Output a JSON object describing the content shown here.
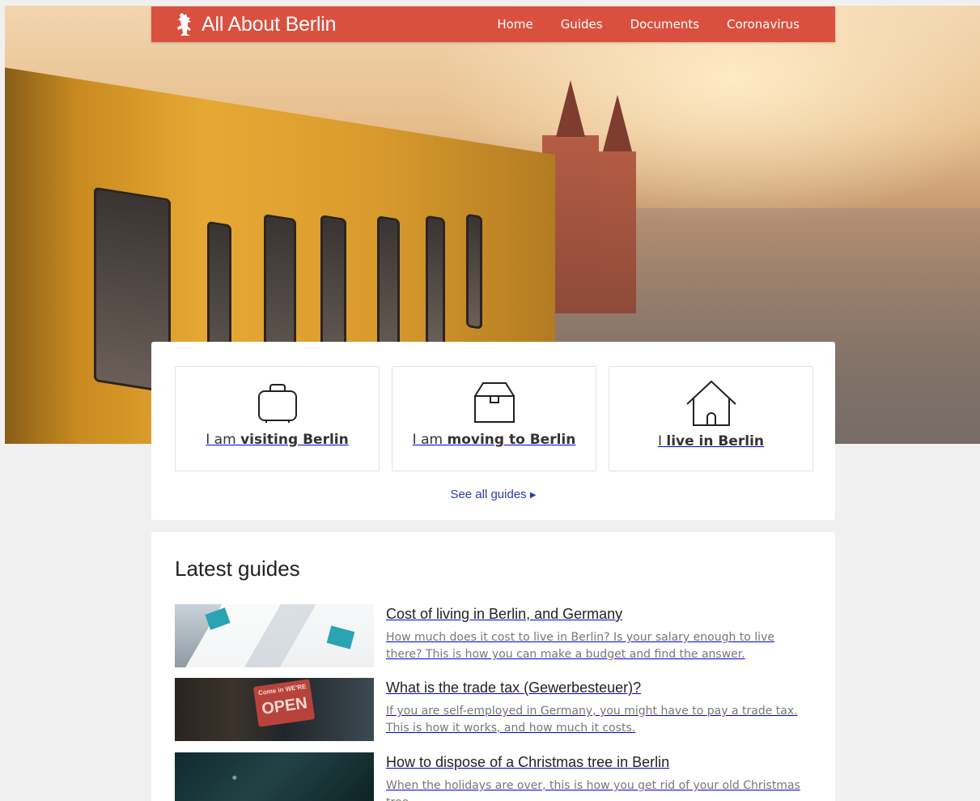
{
  "nav": {
    "brand": "All About Berlin",
    "links": [
      "Home",
      "Guides",
      "Documents",
      "Coronavirus"
    ]
  },
  "personas": [
    {
      "prefix": "I am ",
      "strong": "visiting Berlin",
      "icon": "suitcase-icon"
    },
    {
      "prefix": "I am ",
      "strong": "moving to Berlin",
      "icon": "box-icon"
    },
    {
      "prefix": "I ",
      "strong": "live in Berlin",
      "icon": "house-icon"
    }
  ],
  "see_all": "See all guides",
  "latest": {
    "title": "Latest guides",
    "items": [
      {
        "title": "Cost of living in Berlin, and Germany",
        "desc": "How much does it cost to live in Berlin? Is your salary enough to live there? This is how you can make a budget and find the answer.",
        "thumb_sign_top": "",
        "thumb_sign": ""
      },
      {
        "title": "What is the trade tax (Gewerbesteuer)?",
        "desc": "If you are self-employed in Germany, you might have to pay a trade tax. This is how it works, and how much it costs.",
        "thumb_sign_top": "Come in WE'RE",
        "thumb_sign": "OPEN"
      },
      {
        "title": "How to dispose of a Christmas tree in Berlin",
        "desc": "When the holidays are over, this is how you get rid of your old Christmas tree.",
        "thumb_sign_top": "",
        "thumb_sign": ""
      }
    ]
  },
  "colors": {
    "brand": "#d9503f",
    "link": "#2a3ca8",
    "background": "#f0f0f0"
  }
}
